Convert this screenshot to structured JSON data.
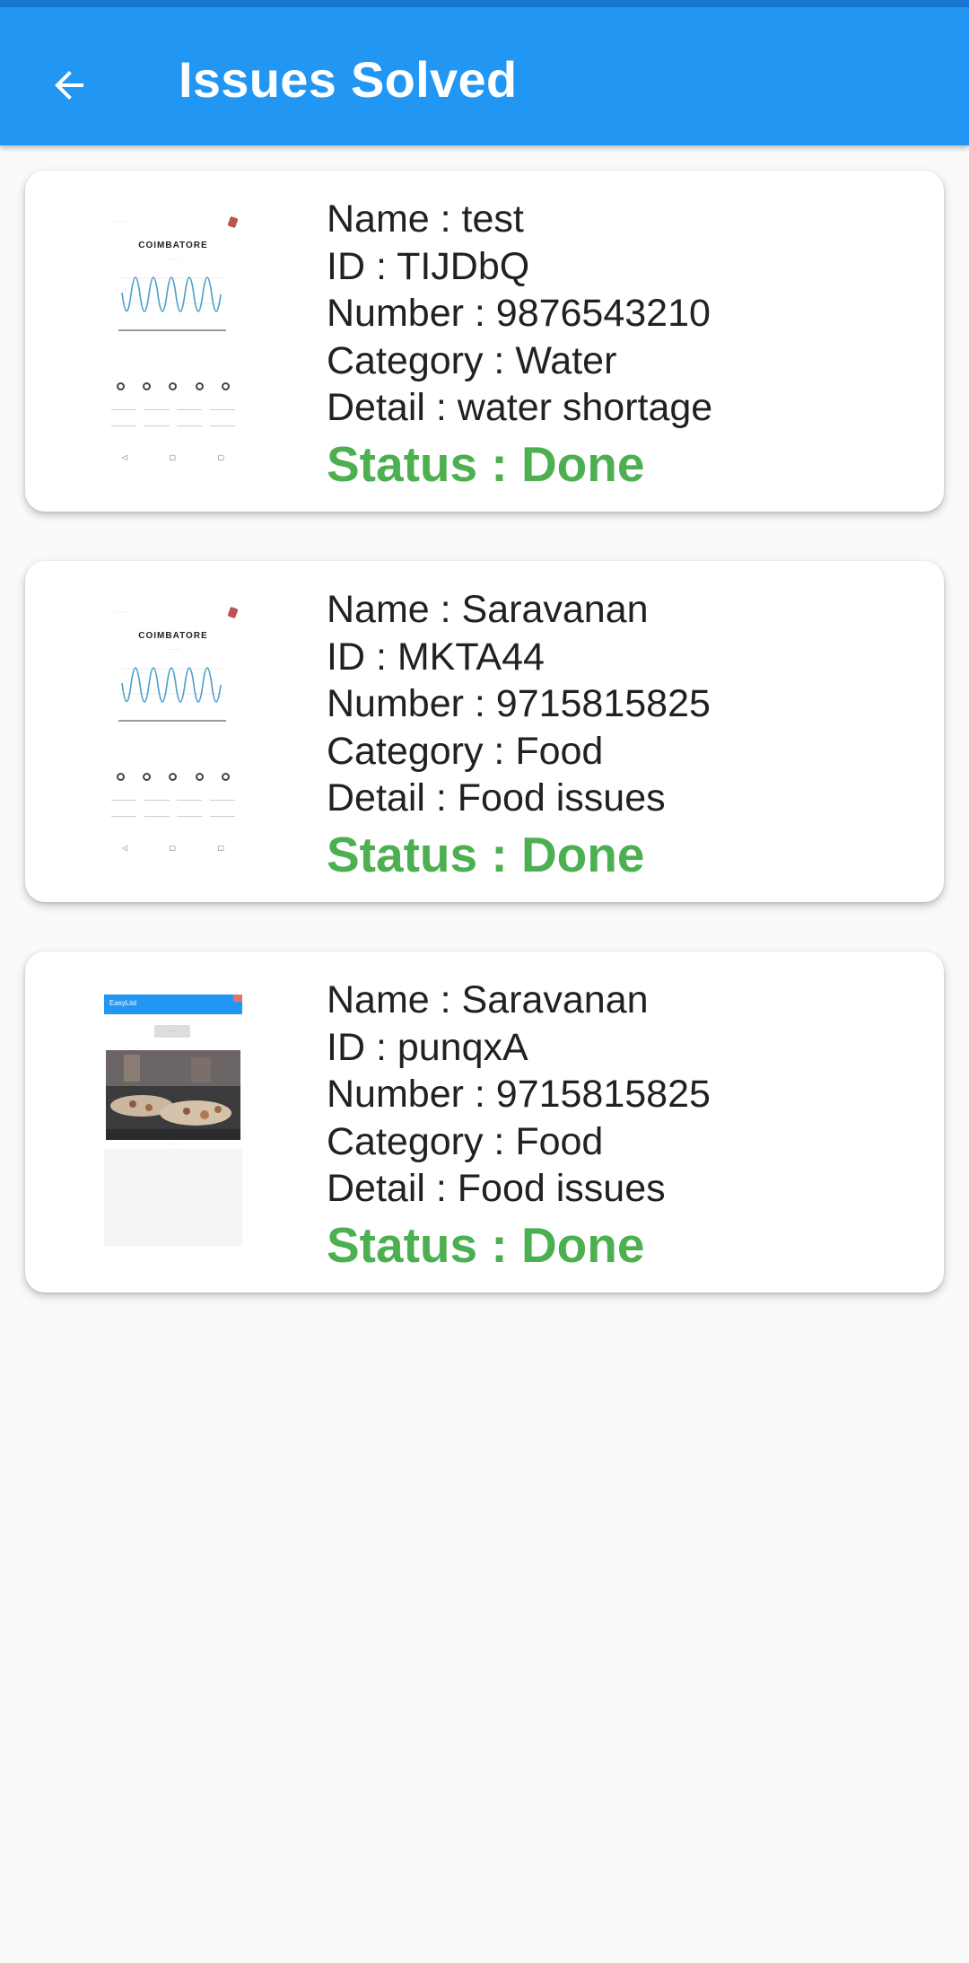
{
  "app_bar": {
    "title": "Issues Solved",
    "back_icon": "arrow-back-icon",
    "color": "#2196F3"
  },
  "issues": [
    {
      "name_line": "Name : test",
      "id_line": "ID : TIJDbQ",
      "number_line": "Number : 9876543210",
      "category_line": "Category : Water",
      "detail_line": "Detail : water shortage",
      "status_line": "Status : Done",
      "thumbnail": "weather-screenshot-thumbnail",
      "thumb_city": "COIMBATORE"
    },
    {
      "name_line": "Name : Saravanan",
      "id_line": "ID : MKTA44",
      "number_line": "Number : 9715815825",
      "category_line": "Category : Food",
      "detail_line": "Detail : Food issues",
      "status_line": "Status : Done",
      "thumbnail": "weather-screenshot-thumbnail",
      "thumb_city": "COIMBATORE"
    },
    {
      "name_line": "Name : Saravanan",
      "id_line": "ID : punqxA",
      "number_line": "Number : 9715815825",
      "category_line": "Category : Food",
      "detail_line": "Detail : Food issues",
      "status_line": "Status : Done",
      "thumbnail": "food-screenshot-thumbnail",
      "thumb_app_title": "EasyList"
    }
  ],
  "colors": {
    "status_done": "#4CAF50",
    "accent": "#2196F3",
    "background": "#fafafa"
  }
}
